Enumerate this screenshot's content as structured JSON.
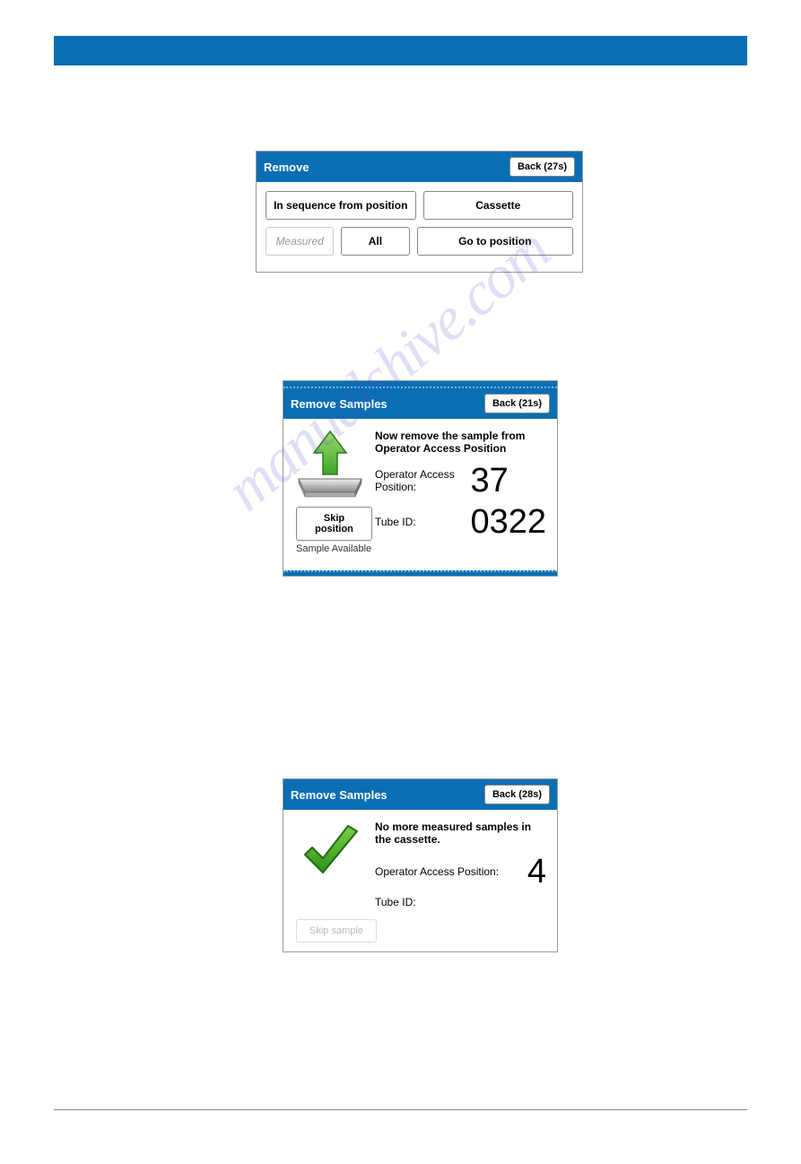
{
  "watermark": "manualshive.com",
  "dialog1": {
    "title": "Remove",
    "back": "Back (27s)",
    "btn_seq": "In sequence from position",
    "btn_cassette": "Cassette",
    "btn_measured": "Measured",
    "btn_all": "All",
    "btn_goto": "Go to position"
  },
  "dialog2": {
    "title": "Remove Samples",
    "back": "Back (21s)",
    "msg": "Now remove the sample from Operator Access Position",
    "pos_label": "Operator Access Position:",
    "pos_val": "37",
    "tube_label": "Tube ID:",
    "tube_val": "0322",
    "skip_btn": "Skip position",
    "skip_status": "Sample Available"
  },
  "dialog3": {
    "title": "Remove Samples",
    "back": "Back (28s)",
    "msg": "No more measured samples in the cassette.",
    "pos_label": "Operator Access Position:",
    "pos_val": "4",
    "tube_label": "Tube ID:",
    "tube_val": "",
    "skip_btn": "Skip sample"
  }
}
